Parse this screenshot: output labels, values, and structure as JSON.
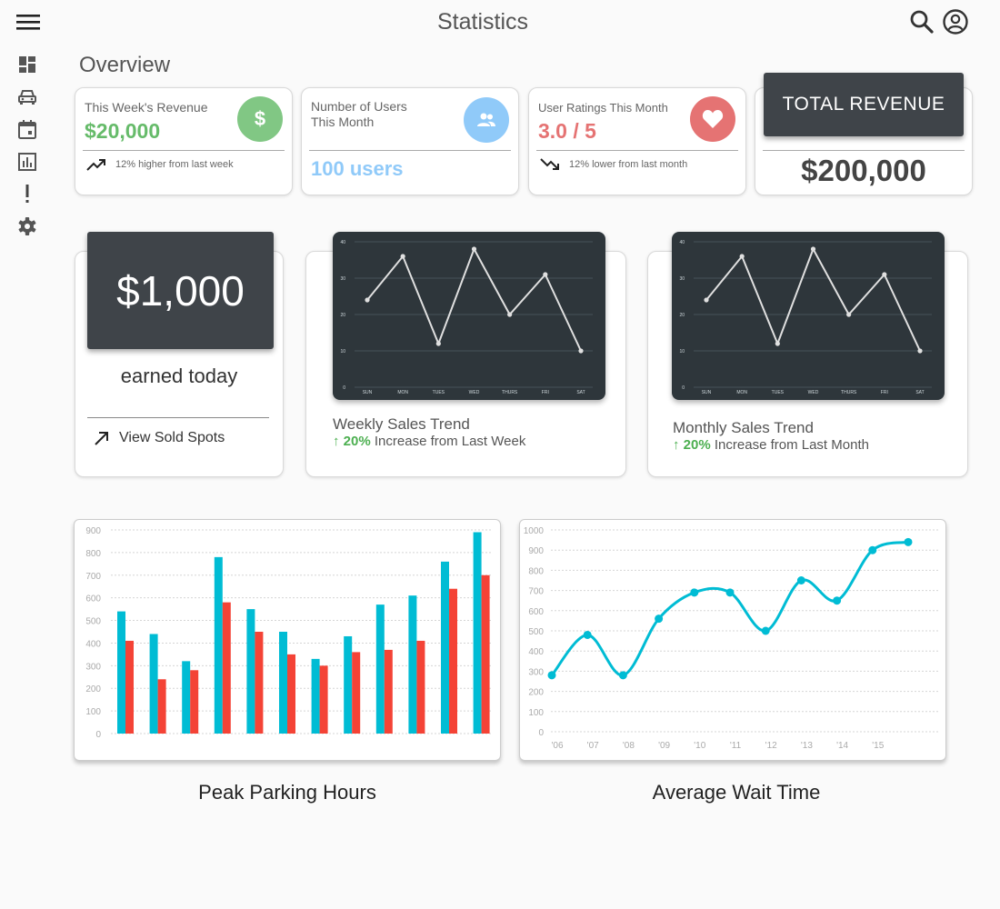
{
  "header": {
    "title": "Statistics"
  },
  "icons": {
    "menu": "hamburger-icon",
    "search": "search-icon",
    "account": "account-circle-icon",
    "sidebar": [
      "dashboard-icon",
      "car-icon",
      "calendar-icon",
      "bar-chart-icon",
      "alert-icon",
      "gear-icon"
    ]
  },
  "overview": {
    "title": "Overview"
  },
  "cards": {
    "weekly_revenue": {
      "label": "This Week's Revenue",
      "value": "$20,000",
      "footer": "12% higher from last week",
      "circle_symbol": "$"
    },
    "users": {
      "label_line1": "Number of Users",
      "label_line2": "This Month",
      "value": "100 users"
    },
    "ratings": {
      "label": "User Ratings This Month",
      "value": "3.0 / 5",
      "footer": "12% lower from last month"
    },
    "total_revenue": {
      "label": "TOTAL REVENUE",
      "value": "$200,000"
    }
  },
  "today": {
    "amount": "$1,000",
    "caption": "earned today",
    "link": "View Sold Spots"
  },
  "weekly_trend": {
    "title": "Weekly Sales Trend",
    "arrow": "↑",
    "pct": "20%",
    "text": "Increase from Last Week"
  },
  "monthly_trend": {
    "title": "Monthly Sales Trend",
    "arrow": "↑",
    "pct": "20%",
    "text": "Increase from Last Month"
  },
  "captions": {
    "peak": "Peak Parking Hours",
    "wait": "Average Wait Time"
  },
  "colors": {
    "green": "#4caf50",
    "green_circle": "#81c784",
    "blue": "#90caf9",
    "red": "#e57373",
    "teal": "#00bcd4",
    "bar_red": "#f44336",
    "dark": "#2e363b"
  },
  "chart_data": [
    {
      "type": "line",
      "categories": [
        "SUN",
        "MON",
        "TUES",
        "WED",
        "THURS",
        "FRI",
        "SAT"
      ],
      "values": [
        24,
        36,
        12,
        38,
        20,
        31,
        10
      ],
      "ylim": [
        0,
        40
      ],
      "yticks": [
        0,
        10,
        20,
        30,
        40
      ],
      "grid": true
    },
    {
      "type": "line",
      "categories": [
        "SUN",
        "MON",
        "TUES",
        "WED",
        "THURS",
        "FRI",
        "SAT"
      ],
      "values": [
        24,
        36,
        12,
        38,
        20,
        31,
        10
      ],
      "ylim": [
        0,
        40
      ],
      "yticks": [
        0,
        10,
        20,
        30,
        40
      ],
      "grid": true
    },
    {
      "type": "bar",
      "series": [
        {
          "values": [
            540,
            440,
            320,
            780,
            550,
            450,
            330,
            430,
            570,
            610,
            760,
            890
          ]
        },
        {
          "values": [
            410,
            240,
            280,
            580,
            450,
            350,
            300,
            360,
            370,
            410,
            640,
            700
          ]
        }
      ],
      "ylim": [
        0,
        900
      ],
      "yticks": [
        0,
        100,
        200,
        300,
        400,
        500,
        600,
        700,
        800,
        900
      ],
      "grid": true
    },
    {
      "type": "line",
      "x": [
        "'06",
        "'07",
        "'08",
        "'09",
        "'10",
        "'11",
        "'12",
        "'13",
        "'14",
        "'15"
      ],
      "values": [
        280,
        480,
        280,
        560,
        690,
        690,
        500,
        750,
        650,
        900,
        940
      ],
      "ylim": [
        0,
        1000
      ],
      "yticks": [
        0,
        100,
        200,
        300,
        400,
        500,
        600,
        700,
        800,
        900,
        1000
      ],
      "grid": true
    }
  ]
}
